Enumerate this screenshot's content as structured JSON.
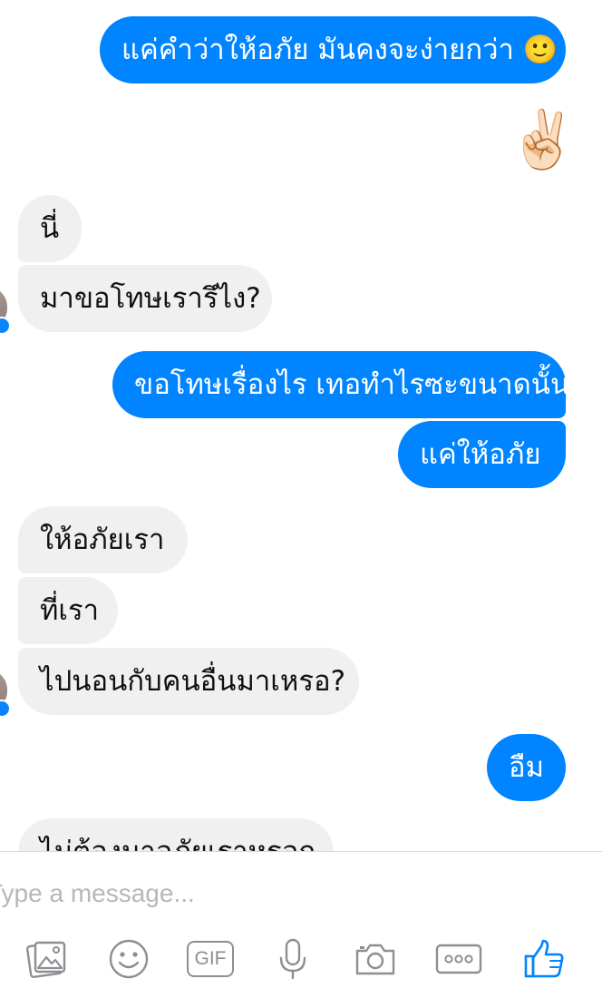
{
  "conversation": {
    "messages": [
      {
        "direction": "outgoing",
        "text": "แค่คำว่าให้อภัย มันคงจะง่ายกว่า 🙂"
      },
      {
        "direction": "outgoing",
        "text": "✌🏻"
      },
      {
        "direction": "incoming",
        "text": "นี่"
      },
      {
        "direction": "incoming",
        "text": "มาขอโทษเรารึไง?"
      },
      {
        "direction": "outgoing",
        "text": "ขอโทษเรื่องไร เทอทำไรซะขนาดนั้น"
      },
      {
        "direction": "outgoing",
        "text": "แค่ให้อภัย"
      },
      {
        "direction": "incoming",
        "text": "ให้อภัยเรา"
      },
      {
        "direction": "incoming",
        "text": "ที่เรา"
      },
      {
        "direction": "incoming",
        "text": "ไปนอนกับคนอื่นมาเหรอ?"
      },
      {
        "direction": "outgoing",
        "text": "อืม"
      },
      {
        "direction": "incoming",
        "text": "ไม่ต้องมาอภัยเราหรอก"
      }
    ]
  },
  "composer": {
    "placeholder": "Type a message...",
    "toolbar": {
      "gif_label": "GIF",
      "icons": [
        "gallery-icon",
        "emoji-icon",
        "gif-icon",
        "microphone-icon",
        "camera-icon",
        "more-icon",
        "like-icon"
      ]
    }
  },
  "colors": {
    "outgoing_bubble": "#0084ff",
    "incoming_bubble": "#f1f0f0",
    "toolbar_icon": "#8e8e93",
    "like_icon": "#0084ff"
  }
}
